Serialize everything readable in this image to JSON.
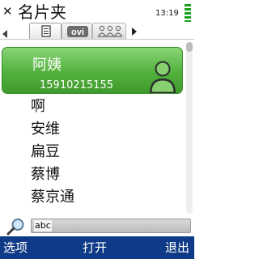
{
  "header": {
    "close_glyph": "✕",
    "title": "名片夹",
    "clock": "13:19"
  },
  "tabs": [
    {
      "name": "list",
      "icon": "contact-list-icon",
      "active": true
    },
    {
      "name": "ovi",
      "label": "ovi",
      "active": false
    },
    {
      "name": "groups",
      "icon": "groups-icon",
      "active": false
    }
  ],
  "contacts": {
    "selected": {
      "name": "阿姨",
      "phone": "15910215155",
      "icon": "contact-avatar-icon"
    },
    "items": [
      "啊",
      "安维",
      "扁豆",
      "蔡博",
      "蔡京通"
    ]
  },
  "search": {
    "value": "abc",
    "icon": "search-icon"
  },
  "softkeys": {
    "left": "选项",
    "middle": "打开",
    "right": "退出"
  },
  "colors": {
    "highlight": "#52b13c",
    "softkey_bar": "#0f3a87",
    "avatar": "#2d2d2d"
  }
}
